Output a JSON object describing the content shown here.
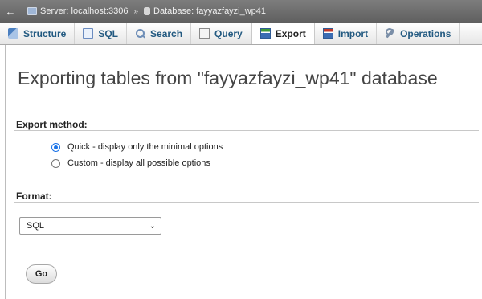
{
  "breadcrumb": {
    "back_glyph": "←",
    "server_label": "Server: localhost:3306",
    "separator": "»",
    "database_label": "Database: fayyazfayzi_wp41"
  },
  "tabs": [
    {
      "label": "Structure",
      "icon": "structure-icon"
    },
    {
      "label": "SQL",
      "icon": "sql-icon"
    },
    {
      "label": "Search",
      "icon": "search-icon"
    },
    {
      "label": "Query",
      "icon": "query-icon"
    },
    {
      "label": "Export",
      "icon": "export-icon",
      "active": true
    },
    {
      "label": "Import",
      "icon": "import-icon"
    },
    {
      "label": "Operations",
      "icon": "operations-icon"
    }
  ],
  "page": {
    "title": "Exporting tables from \"fayyazfayzi_wp41\" database"
  },
  "export_method": {
    "label": "Export method:",
    "options": [
      {
        "label": "Quick - display only the minimal options",
        "checked": true
      },
      {
        "label": "Custom - display all possible options",
        "checked": false
      }
    ]
  },
  "format": {
    "label": "Format:",
    "selected": "SQL"
  },
  "go_button": {
    "label": "Go"
  },
  "colors": {
    "tab_text": "#235a81",
    "radio_accent": "#1a73e8",
    "topbar": "#6e6e6e"
  }
}
